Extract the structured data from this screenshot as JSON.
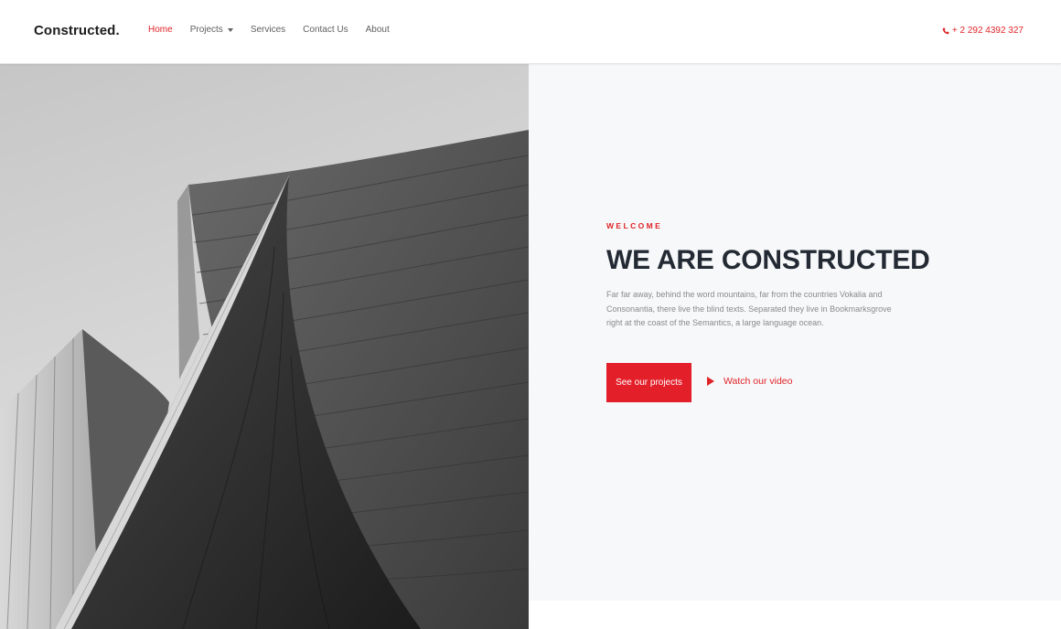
{
  "brand": {
    "name": "Constructed",
    "dot": "."
  },
  "nav": {
    "items": [
      {
        "label": "Home",
        "active": true
      },
      {
        "label": "Projects",
        "dropdown": true
      },
      {
        "label": "Services"
      },
      {
        "label": "Contact Us"
      },
      {
        "label": "About"
      }
    ]
  },
  "phone": {
    "icon": "phone-icon",
    "text": "+ 2 292 4392 327"
  },
  "hero": {
    "eyebrow": "WELCOME",
    "title": "WE ARE CONSTRUCTED",
    "description": "Far far away, behind the word mountains, far from the countries Vokalia and Consonantia, there live the blind texts. Separated they live in Bookmarksgrove right at the coast of the Semantics, a large language ocean.",
    "primary_button": "See our projects",
    "video_link": "Watch our video",
    "image": "architecture-photo"
  },
  "colors": {
    "accent": "#e02327",
    "heading": "#232a33",
    "panel": "#f7f8fa"
  }
}
